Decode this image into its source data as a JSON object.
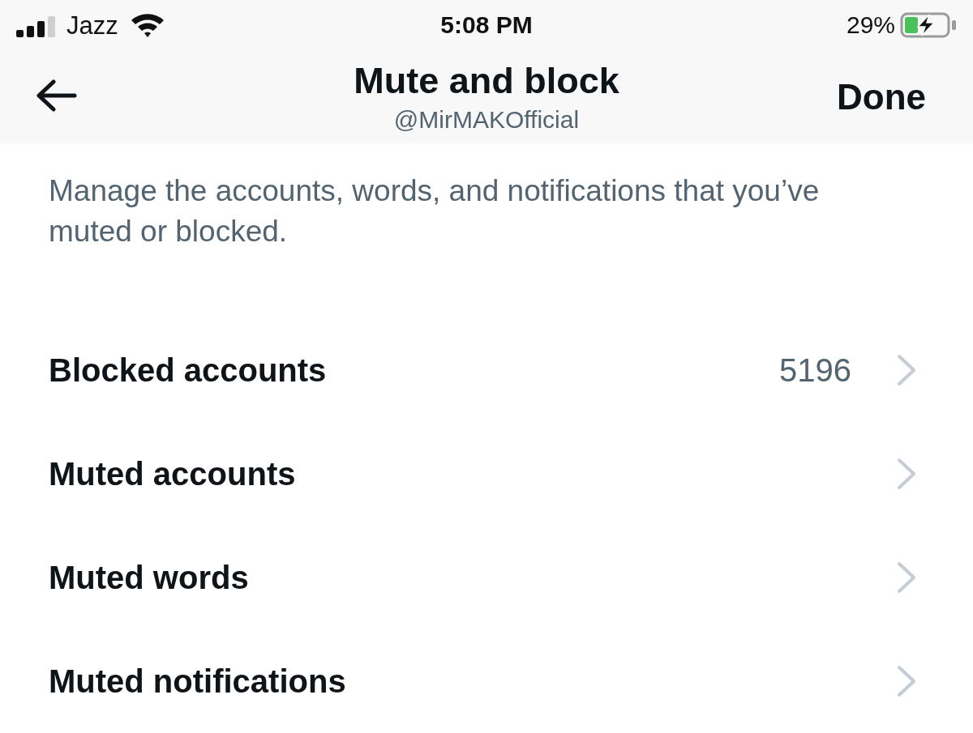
{
  "status_bar": {
    "carrier": "Jazz",
    "time": "5:08 PM",
    "battery": "29%"
  },
  "header": {
    "title": "Mute and block",
    "subtitle": "@MirMAKOfficial",
    "done": "Done"
  },
  "description": "Manage the accounts, words, and notifications that you’ve muted or blocked.",
  "items": [
    {
      "label": "Blocked accounts",
      "count": "5196"
    },
    {
      "label": "Muted accounts"
    },
    {
      "label": "Muted words"
    },
    {
      "label": "Muted notifications"
    }
  ]
}
